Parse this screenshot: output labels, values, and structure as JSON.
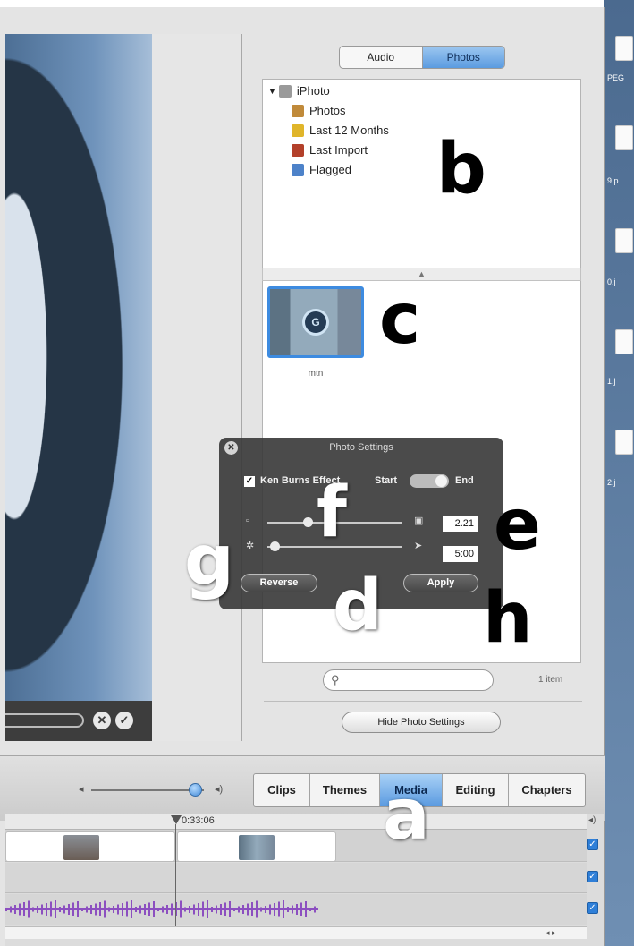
{
  "desktop": {
    "file_labels": [
      "PEG",
      "9.p",
      "0.j",
      "1.j",
      "2.j"
    ]
  },
  "viewer": {
    "cancel_label": "✕",
    "confirm_label": "✓"
  },
  "media_pane": {
    "segmented": {
      "audio_label": "Audio",
      "photos_label": "Photos",
      "selected": "Photos"
    },
    "source_list": {
      "root": {
        "label": "iPhoto",
        "disclosure": "▼"
      },
      "items": [
        {
          "label": "Photos",
          "icon": "photos-icon",
          "color": "#c08a3a"
        },
        {
          "label": "Last 12 Months",
          "icon": "calendar-icon",
          "color": "#e0b52a"
        },
        {
          "label": "Last Import",
          "icon": "import-icon",
          "color": "#b3402a"
        },
        {
          "label": "Flagged",
          "icon": "flag-icon",
          "color": "#4d82c9"
        }
      ]
    },
    "splitter_glyph": "▲",
    "thumbnail": {
      "caption": "mtn"
    },
    "search": {
      "placeholder": ""
    },
    "item_count": "1 item",
    "hide_settings_label": "Hide Photo Settings"
  },
  "photo_settings": {
    "title": "Photo Settings",
    "close_label": "✕",
    "ken_burns": {
      "label": "Ken Burns Effect",
      "checked": true,
      "check_glyph": "✓"
    },
    "start_label": "Start",
    "end_label": "End",
    "zoom": {
      "value": "2.21",
      "level": 0.3
    },
    "duration": {
      "value": "5:00",
      "level": 0.05
    },
    "reverse_label": "Reverse",
    "apply_label": "Apply"
  },
  "toolbar": {
    "volume_level": 0.92,
    "tabs": [
      {
        "label": "Clips",
        "active": false
      },
      {
        "label": "Themes",
        "active": false
      },
      {
        "label": "Media",
        "active": true
      },
      {
        "label": "Editing",
        "active": false
      },
      {
        "label": "Chapters",
        "active": false
      }
    ]
  },
  "timeline": {
    "playhead_time": "0:33:06",
    "track_check_glyph": "✓"
  },
  "annotations": [
    "a",
    "b",
    "c",
    "d",
    "e",
    "f",
    "g",
    "h"
  ],
  "colors": {
    "selection_blue": "#3d8be0",
    "hud_background": "#373737",
    "audio_waveform": "#8c4fc0"
  }
}
